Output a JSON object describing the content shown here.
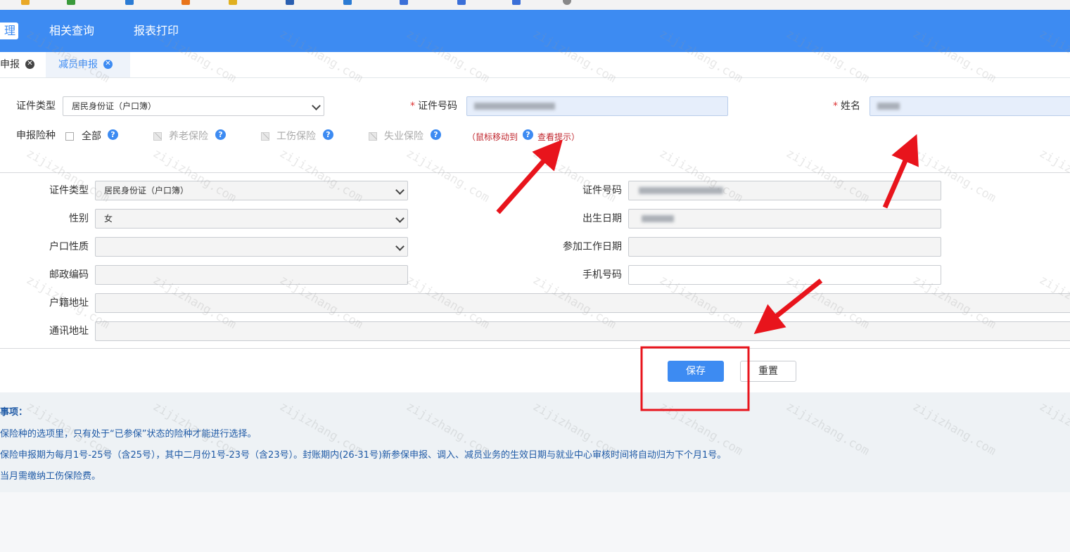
{
  "topnav": {
    "active_label": "理",
    "items": [
      "相关查询",
      "报表打印"
    ]
  },
  "tabs": [
    {
      "label": "申报"
    },
    {
      "label": "减员申报"
    }
  ],
  "top_form": {
    "id_type_label": "证件类型",
    "id_type_value": "居民身份证（户口簿）",
    "id_number_label": "证件号码",
    "name_label": "姓名",
    "insurance_label": "申报险种",
    "options": [
      {
        "label": "全部",
        "disabled": false
      },
      {
        "label": "养老保险",
        "disabled": true
      },
      {
        "label": "工伤保险",
        "disabled": true
      },
      {
        "label": "失业保险",
        "disabled": true
      }
    ],
    "hint_prefix": "（鼠标移动到",
    "hint_suffix": "查看提示）"
  },
  "detail_form": {
    "id_type_label": "证件类型",
    "id_type_value": "居民身份证（户口簿）",
    "gender_label": "性别",
    "gender_value": "女",
    "hukou_type_label": "户口性质",
    "postcode_label": "邮政编码",
    "hukou_address_label": "户籍地址",
    "mail_address_label": "通讯地址",
    "id_number_label": "证件号码",
    "birth_label": "出生日期",
    "work_date_label": "参加工作日期",
    "phone_label": "手机号码"
  },
  "buttons": {
    "save": "保存",
    "reset": "重置"
  },
  "notes": {
    "title": "事项：",
    "lines": [
      "保险种的选项里，只有处于“已参保”状态的险种才能进行选择。",
      "保险申报期为每月1号-25号（含25号），其中二月份1号-23号（含23号）。封账期内(26-31号)新参保申报、调入、减员业务的生效日期与就业中心审核时间将自动归为下个月1号。",
      "当月需缴纳工伤保险费。"
    ]
  },
  "watermark": "zijizhang.com",
  "colors": {
    "primary": "#3d8bf2",
    "required": "#d33333",
    "hint": "#c0262d",
    "notes_text": "#1f5aa6",
    "annotation": "#e8141c"
  }
}
